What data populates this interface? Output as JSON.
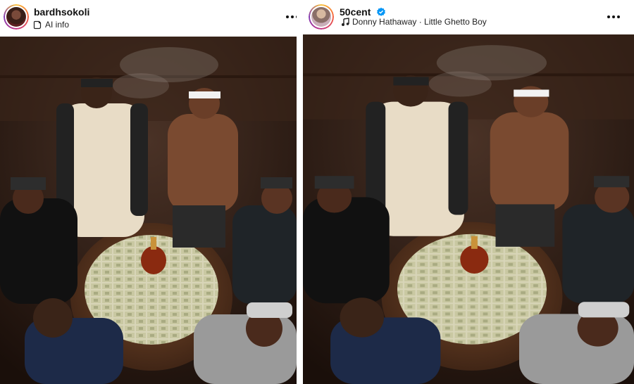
{
  "posts": [
    {
      "username": "bardhsokoli",
      "label_icon": "ai-info-icon",
      "label_text": "AI info",
      "more_icon": "more-horizontal-icon",
      "photo_description_icon": "photo"
    },
    {
      "username": "50cent",
      "verified": true,
      "label_icon": "music-note-icon",
      "label_text": "Donny Hathaway · Little Ghetto Boy",
      "more_icon": "more-horizontal-icon"
    }
  ],
  "colors": {
    "verified_blue": "#0095f6",
    "text_primary": "#111111"
  }
}
